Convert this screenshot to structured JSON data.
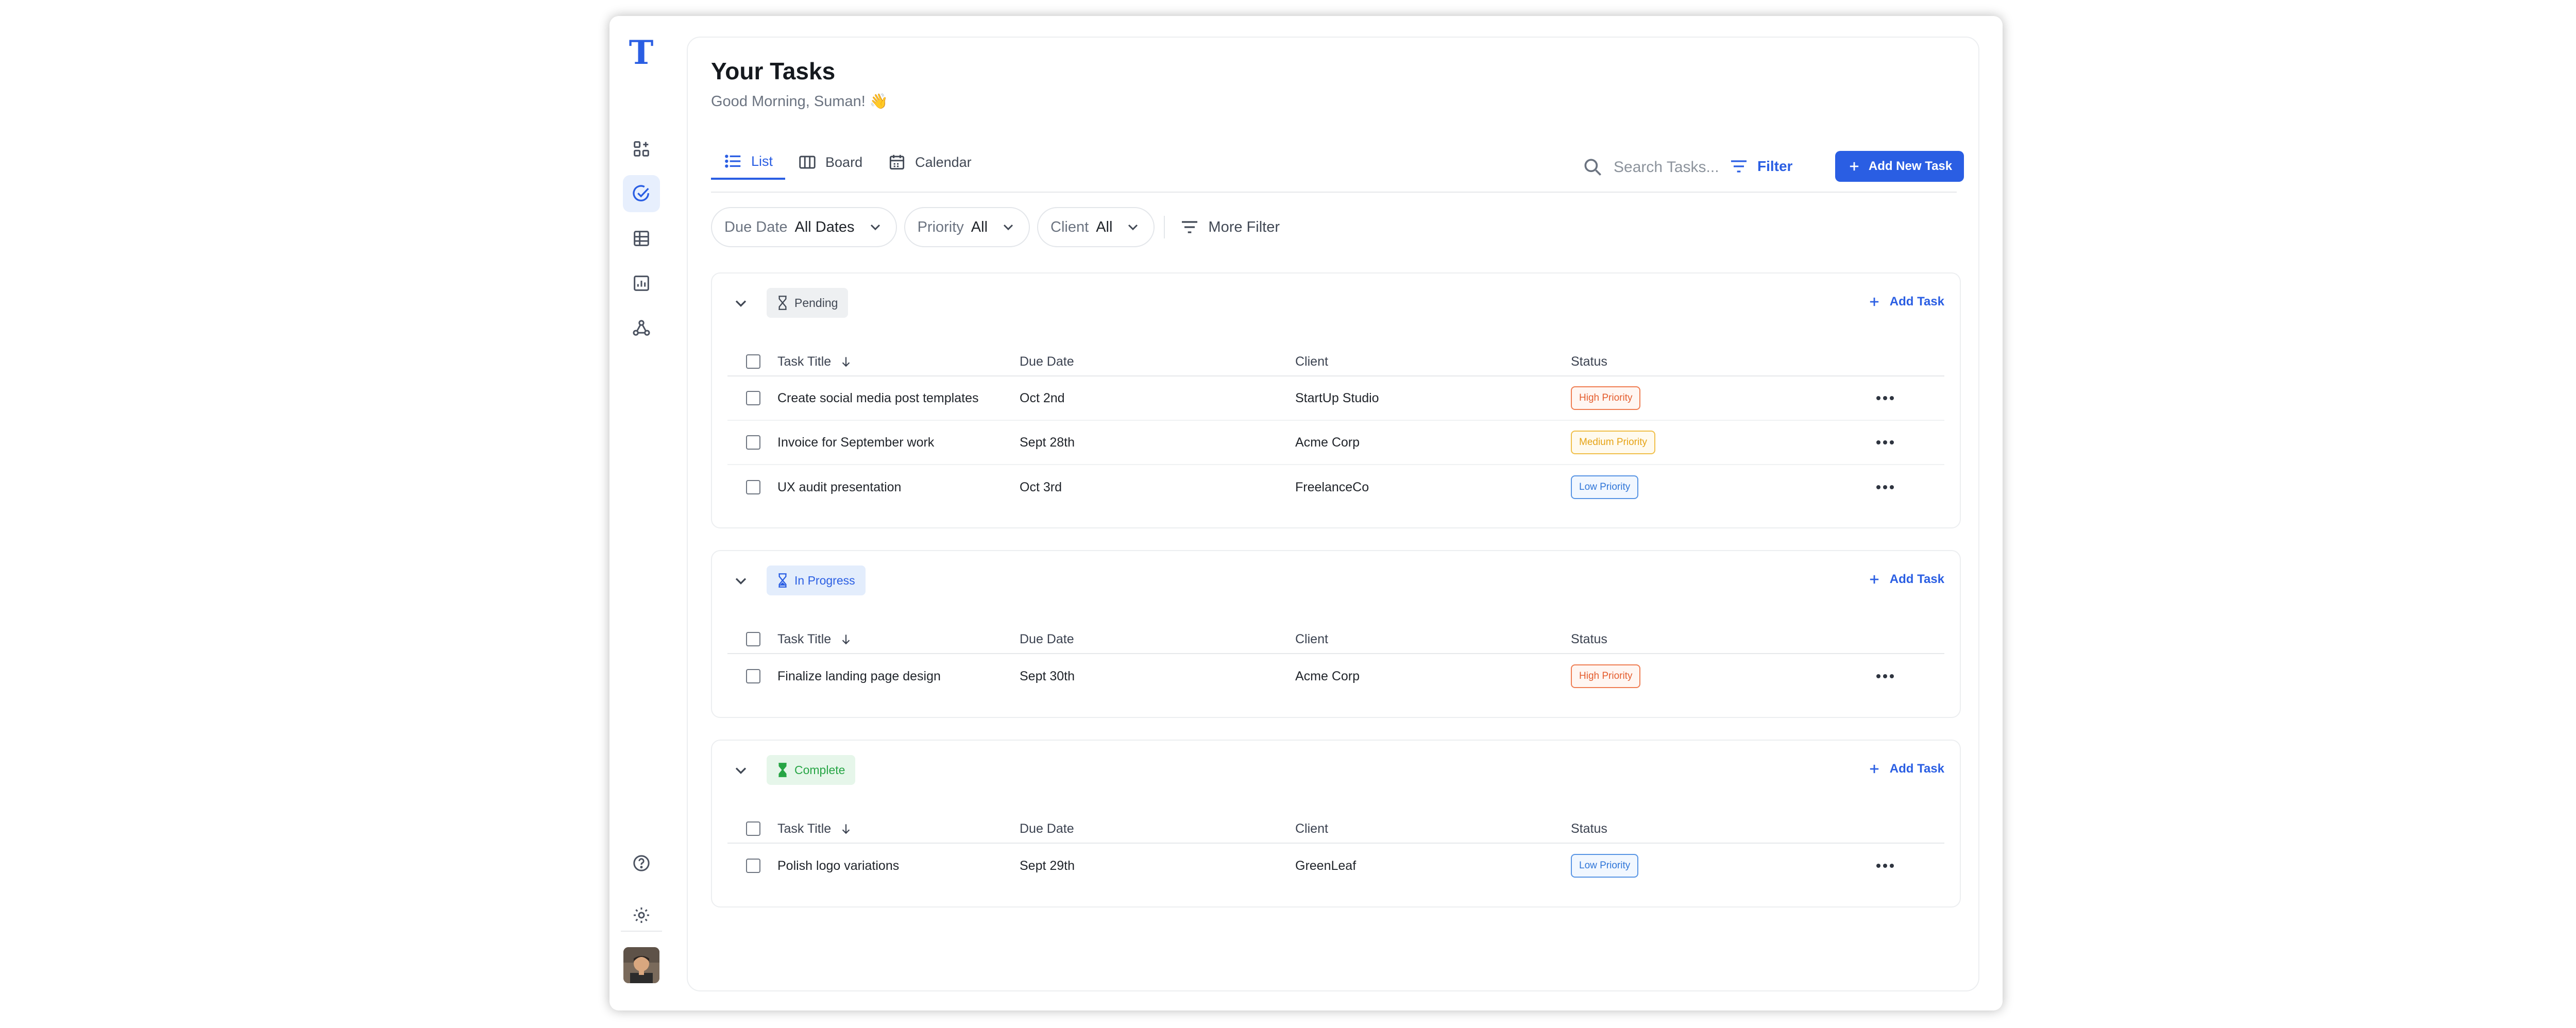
{
  "brand": {
    "logo_letter": "T"
  },
  "sidebar": {
    "items": [
      {
        "name": "dashboard",
        "icon": "dashboard-icon",
        "active": false
      },
      {
        "name": "tasks",
        "icon": "check-circle-icon",
        "active": true
      },
      {
        "name": "table",
        "icon": "grid-icon",
        "active": false
      },
      {
        "name": "reports",
        "icon": "chart-icon",
        "active": false
      },
      {
        "name": "network",
        "icon": "network-icon",
        "active": false
      }
    ],
    "bottom": [
      {
        "name": "help",
        "icon": "help-icon"
      },
      {
        "name": "settings",
        "icon": "gear-icon"
      }
    ]
  },
  "header": {
    "title": "Your Tasks",
    "subtitle": "Good Morning, Suman! 👋"
  },
  "tabs": [
    {
      "label": "List",
      "icon": "list-icon",
      "active": true
    },
    {
      "label": "Board",
      "icon": "board-icon",
      "active": false
    },
    {
      "label": "Calendar",
      "icon": "calendar-icon",
      "active": false
    }
  ],
  "toolbar": {
    "search_placeholder": "Search Tasks...",
    "filter_label": "Filter",
    "add_new_label": "Add New Task"
  },
  "filters": [
    {
      "key": "Due Date",
      "value": "All Dates"
    },
    {
      "key": "Priority",
      "value": "All"
    },
    {
      "key": "Client",
      "value": "All"
    }
  ],
  "more_filter_label": "More Filter",
  "columns": {
    "title": "Task Title",
    "due": "Due Date",
    "client": "Client",
    "status": "Status"
  },
  "groups": [
    {
      "label": "Pending",
      "add_label": "Add Task",
      "rows": [
        {
          "title": "Create social media post templates",
          "due": "Oct 2nd",
          "client": "StartUp Studio",
          "status": "High Priority"
        },
        {
          "title": "Invoice for September work",
          "due": "Sept 28th",
          "client": "Acme Corp",
          "status": "Medium Priority"
        },
        {
          "title": "UX audit presentation",
          "due": "Oct 3rd",
          "client": "FreelanceCo",
          "status": "Low Priority"
        }
      ]
    },
    {
      "label": "In Progress",
      "add_label": "Add Task",
      "rows": [
        {
          "title": "Finalize landing page design",
          "due": "Sept 30th",
          "client": "Acme Corp",
          "status": "High Priority"
        }
      ]
    },
    {
      "label": "Complete",
      "add_label": "Add Task",
      "rows": [
        {
          "title": "Polish logo variations",
          "due": "Sept 29th",
          "client": "GreenLeaf",
          "status": "Low Priority"
        }
      ]
    }
  ],
  "colors": {
    "accent": "#2a5ee3",
    "pending_bg": "#eef0f2",
    "in_progress_bg": "#e3edfc",
    "complete_bg": "#e6f6ea",
    "high": "#e45d2e",
    "medium": "#e6a314",
    "low": "#2e75d8"
  }
}
